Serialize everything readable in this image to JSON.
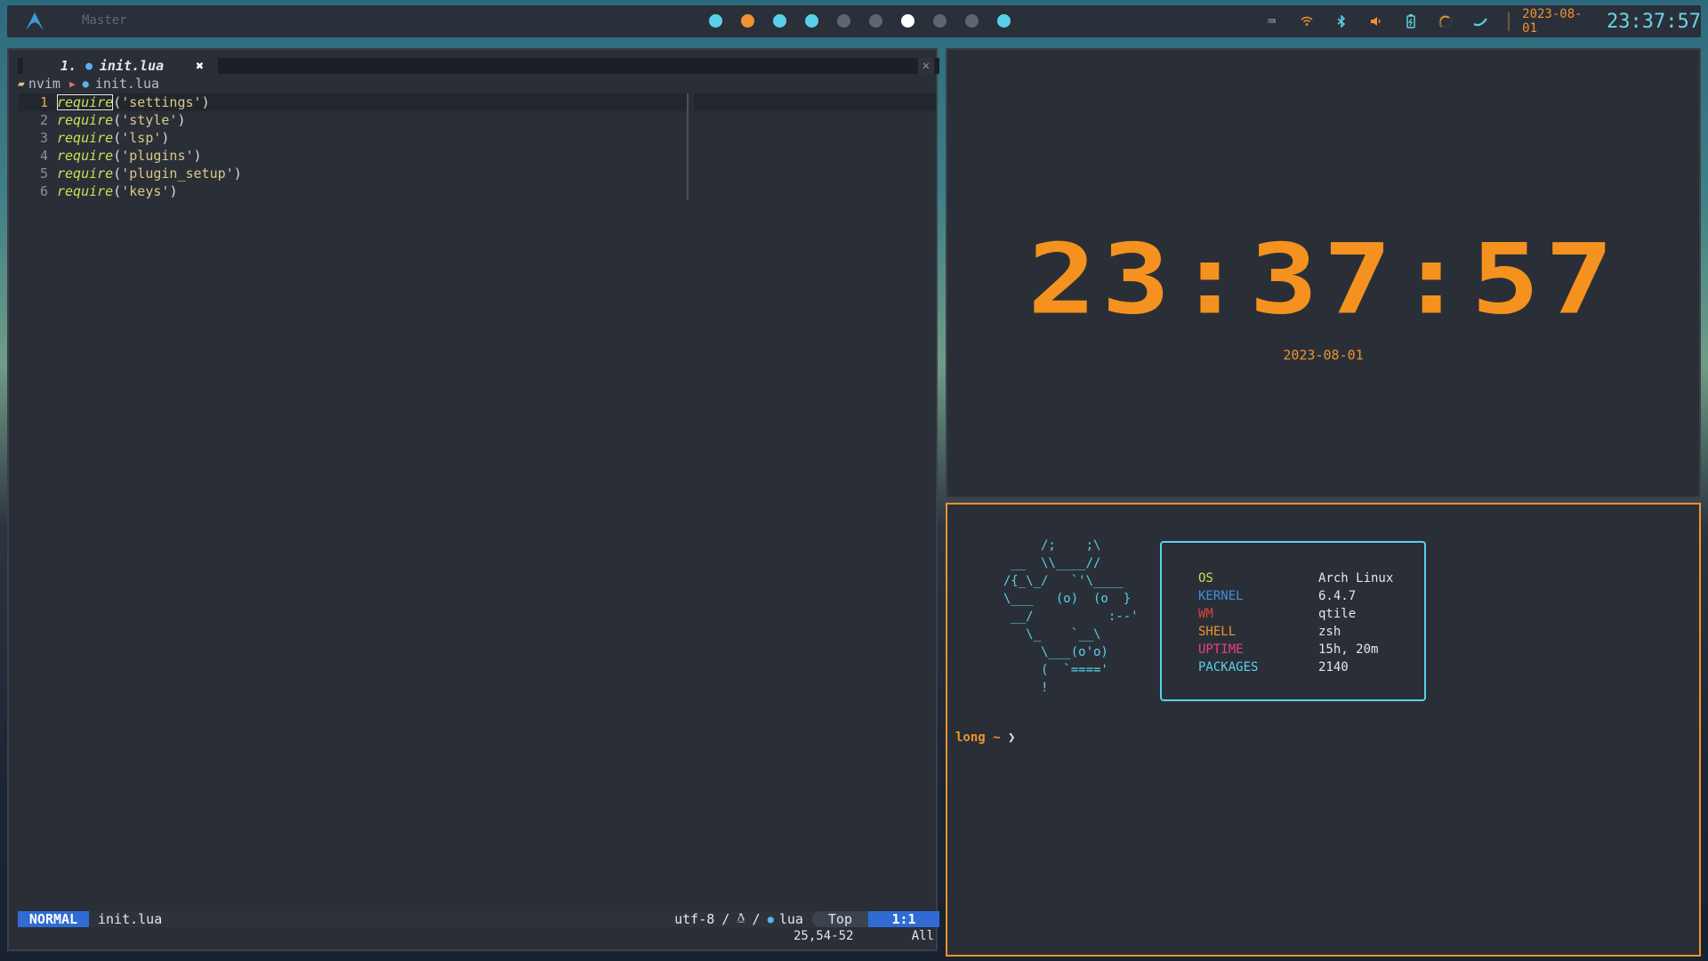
{
  "topbar": {
    "layout_name": "Master",
    "group_colors": [
      "#5ad0e8",
      "#f0922e",
      "#5ad0e8",
      "#5ad0e8",
      "#5f6670",
      "#5f6670",
      "#ffffff",
      "#5f6670",
      "#5f6670",
      "#5ad0e8"
    ],
    "tray_icons": [
      "keyboard-icon",
      "wifi-icon",
      "bluetooth-icon",
      "volume-icon",
      "battery-icon",
      "brightness-icon",
      "moon-icon"
    ],
    "date": "2023-08-01",
    "time": "23:37:57"
  },
  "editor": {
    "tab_number": "1.",
    "tab_title": "init.lua",
    "winbar_folder": "nvim",
    "winbar_file": "init.lua",
    "lines": [
      {
        "num": "1",
        "module": "'settings'"
      },
      {
        "num": "2",
        "module": "'style'"
      },
      {
        "num": "3",
        "module": "'lsp'"
      },
      {
        "num": "4",
        "module": "'plugins'"
      },
      {
        "num": "5",
        "module": "'plugin_setup'"
      },
      {
        "num": "6",
        "module": "'keys'"
      }
    ],
    "keyword": "require",
    "statusline": {
      "mode": "NORMAL",
      "file": "init.lua",
      "encoding": "utf-8",
      "filetype": "lua",
      "scroll": "Top",
      "cursor": "1:1"
    },
    "cmdline": {
      "position": "25,54-52",
      "all": "All"
    }
  },
  "clock": {
    "time": "23:37:57",
    "date": "2023-08-01"
  },
  "terminal": {
    "ascii_art": "       /;    ;\\\n   __  \\\\____//\n  /{_\\_/   `'\\____\n  \\___   (o)  (o  }\n   __/          :--'\n     \\_    `__\\\n       \\___(o'o)\n       (  `===='\n       !",
    "sysinfo": [
      {
        "key": "OS",
        "value": "Arch Linux",
        "color": "#c7e256"
      },
      {
        "key": "KERNEL",
        "value": "6.4.7",
        "color": "#3d8fe0"
      },
      {
        "key": "WM",
        "value": "qtile",
        "color": "#e0403a"
      },
      {
        "key": "SHELL",
        "value": "zsh",
        "color": "#f0922e"
      },
      {
        "key": "UPTIME",
        "value": "15h, 20m",
        "color": "#e8437a"
      },
      {
        "key": "PACKAGES",
        "value": "2140",
        "color": "#5ad0e8"
      }
    ],
    "prompt_user": "long ~",
    "prompt_arrow": "❯"
  }
}
